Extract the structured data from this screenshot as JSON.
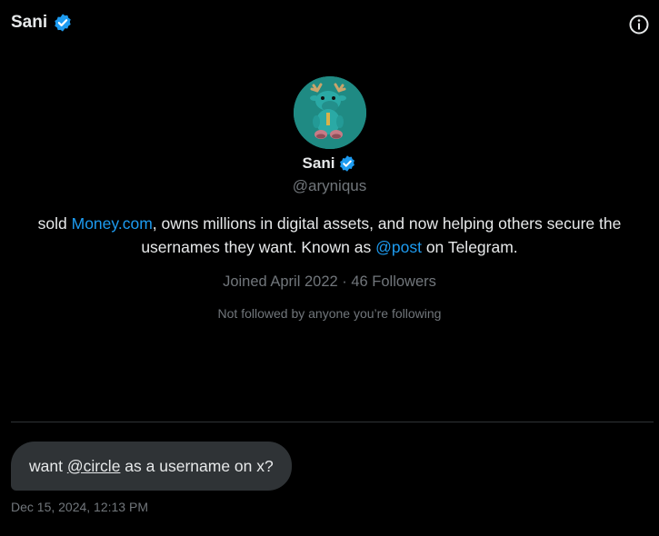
{
  "header": {
    "name": "Sani",
    "verified_icon": "verified-badge-icon",
    "info_icon": "info-icon"
  },
  "profile": {
    "avatar_icon": "moose-avatar",
    "name": "Sani",
    "handle": "@aryniqus",
    "bio": {
      "part1": "sold ",
      "link1": "Money.com",
      "part2": ", owns millions in digital assets, and now helping others secure the usernames they want. Known as ",
      "link2": "@post",
      "part3": " on Telegram."
    },
    "joined": "Joined April 2022",
    "separator": " · ",
    "followers": "46 Followers",
    "not_followed": "Not followed by anyone you’re following"
  },
  "message": {
    "before": "want ",
    "mention": "@circle",
    "after": " as a username on x?",
    "timestamp": "Dec 15, 2024, 12:13 PM"
  },
  "colors": {
    "background": "#000000",
    "text": "#e7e9ea",
    "muted": "#71767b",
    "link": "#1d9bf0",
    "bubble": "#2f3336",
    "verified": "#1d9bf0"
  }
}
